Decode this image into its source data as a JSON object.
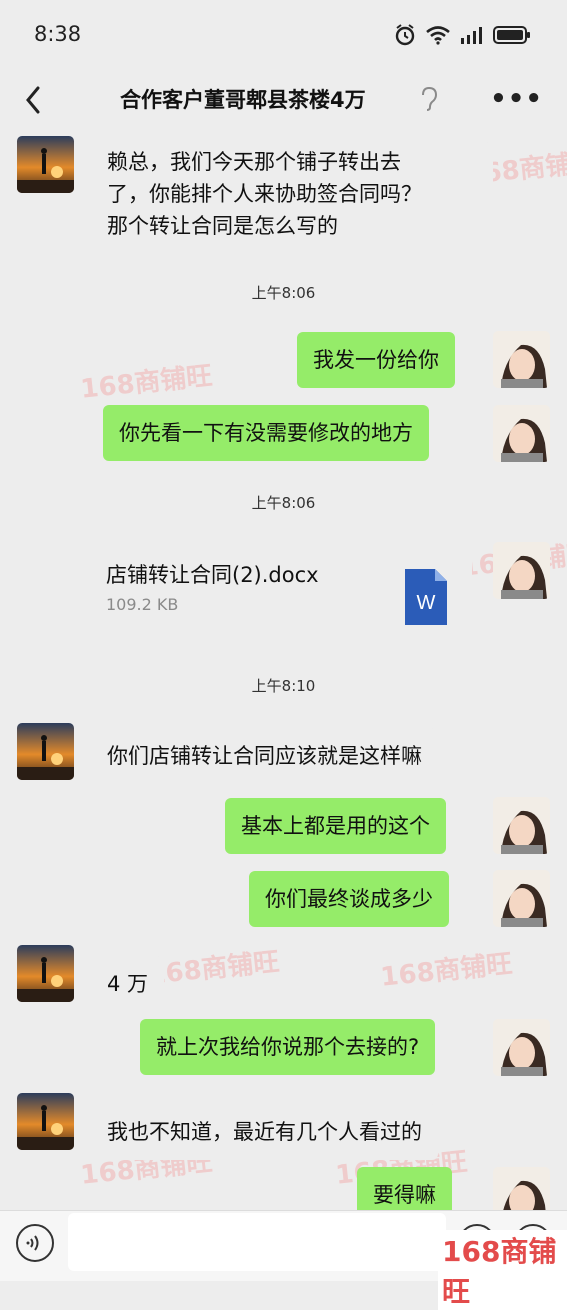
{
  "status": {
    "time": "8:38"
  },
  "header": {
    "title": "合作客户董哥郫县茶楼4万"
  },
  "messages": {
    "m1": "赖总，我们今天那个铺子转出去",
    "m1b": "了，你能排个人来协助签合同吗？",
    "m1c": "那个转让合同是怎么写的",
    "t1": "上午8:06",
    "m2": "我发一份给你",
    "m3": "你先看一下有没需要修改的地方",
    "t2": "上午8:06",
    "file": {
      "name": "店铺转让合同(2).docx",
      "size": "109.2 KB",
      "icon_letter": "W"
    },
    "t3": "上午8:10",
    "m4": "你们店铺转让合同应该就是这样嘛",
    "m5": "基本上都是用的这个",
    "m6": "你们最终谈成多少",
    "m7": "4 万",
    "m8": "就上次我给你说那个去接的?",
    "m9": "我也不知道，最近有几个人看过的",
    "m10": "要得嘛"
  },
  "watermark": "168商铺旺",
  "colors": {
    "bubble_self": "#95ec69",
    "background": "#ededed"
  }
}
